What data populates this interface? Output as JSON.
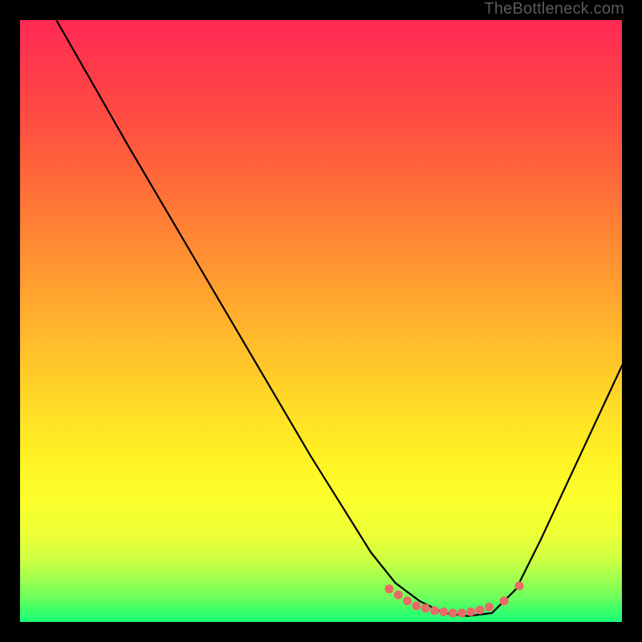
{
  "watermark": "TheBottleneck.com",
  "chart_data": {
    "type": "line",
    "title": "",
    "xlabel": "",
    "ylabel": "",
    "xlim": [
      0,
      100
    ],
    "ylim": [
      0,
      100
    ],
    "grid": false,
    "series": [
      {
        "name": "curve",
        "x": [
          6,
          10,
          18,
          28,
          38,
          48,
          58,
          62,
          66,
          70,
          74,
          78,
          82,
          86,
          100
        ],
        "values": [
          100,
          93,
          79,
          62,
          45,
          28,
          12,
          7,
          4,
          2,
          1.5,
          2,
          6,
          14,
          44
        ]
      }
    ],
    "markers": {
      "name": "valley-dots",
      "x": [
        61,
        62.5,
        64,
        65.5,
        67,
        68.5,
        70,
        71.5,
        73,
        74.5,
        76,
        77.5,
        80,
        82.5
      ],
      "values": [
        6,
        5,
        4,
        3.2,
        2.8,
        2.4,
        2.2,
        2,
        2,
        2.2,
        2.5,
        3,
        4,
        6.5
      ]
    }
  }
}
